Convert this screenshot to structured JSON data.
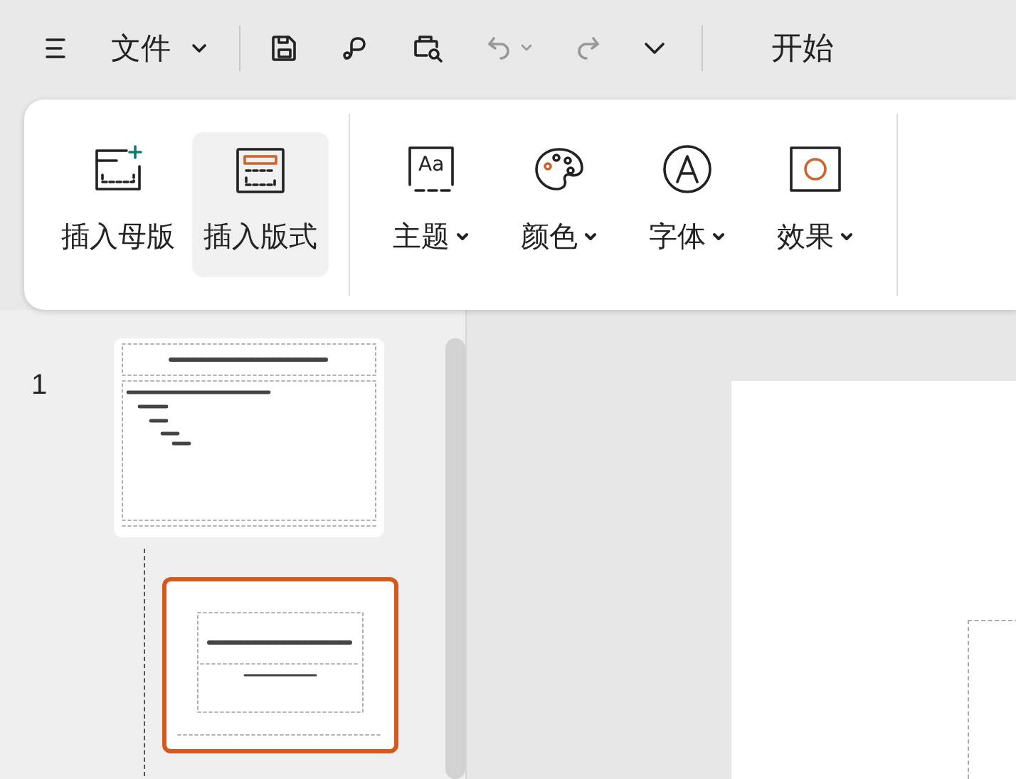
{
  "title_bar": {
    "file_menu": {
      "label": "文件"
    },
    "quick_access": [
      {
        "kind": "save",
        "disabled": false
      },
      {
        "kind": "link",
        "disabled": false
      },
      {
        "kind": "preview",
        "disabled": false
      },
      {
        "kind": "undo",
        "disabled": true
      },
      {
        "kind": "redo",
        "disabled": true
      },
      {
        "kind": "more",
        "disabled": false
      }
    ],
    "tabs": [
      {
        "label": "开始"
      }
    ]
  },
  "ribbon": {
    "groups": [
      {
        "buttons": [
          {
            "kind": "insert-master",
            "label": "插入母版",
            "selected": false
          },
          {
            "kind": "insert-layout",
            "label": "插入版式",
            "selected": true
          }
        ]
      },
      {
        "buttons": [
          {
            "kind": "theme",
            "icon_text": "Aa",
            "label": "主题",
            "selected": false,
            "dropdown": true
          },
          {
            "kind": "colors",
            "label": "颜色",
            "selected": false,
            "dropdown": true
          },
          {
            "kind": "fonts",
            "label": "字体",
            "selected": false,
            "dropdown": true
          },
          {
            "kind": "effects",
            "label": "效果",
            "selected": false,
            "dropdown": true
          }
        ]
      }
    ]
  },
  "slides_panel": {
    "thumbnails": [
      {
        "kind": "master",
        "number": "1",
        "selected": false
      },
      {
        "kind": "layout",
        "selected": true
      }
    ]
  }
}
